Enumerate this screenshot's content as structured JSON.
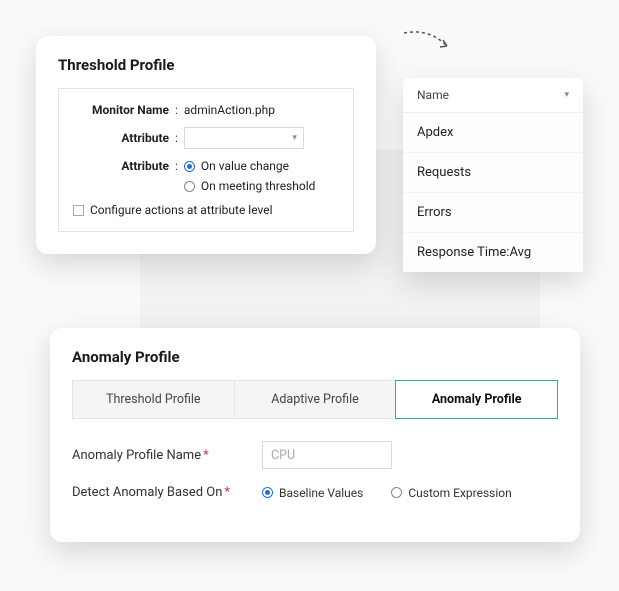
{
  "threshold": {
    "title": "Threshold Profile",
    "monitor_label": "Monitor Name",
    "monitor_value": "adminAction.php",
    "attribute_label": "Attribute",
    "attribute2_label": "Attribute",
    "radio_on_value_change": "On value change",
    "radio_on_meeting_threshold": "On meeting threshold",
    "configure_actions": "Configure actions at attribute level"
  },
  "dropdown": {
    "header": "Name",
    "items": [
      "Apdex",
      "Requests",
      "Errors",
      "Response Time:Avg"
    ]
  },
  "anomaly": {
    "title": "Anomaly Profile",
    "tabs": {
      "threshold": "Threshold Profile",
      "adaptive": "Adaptive Profile",
      "anomaly": "Anomaly Profile"
    },
    "name_label": "Anomaly Profile Name",
    "name_placeholder": "CPU",
    "detect_label": "Detect Anomaly  Based On",
    "radio_baseline": "Baseline Values",
    "radio_custom": "Custom Expression"
  }
}
